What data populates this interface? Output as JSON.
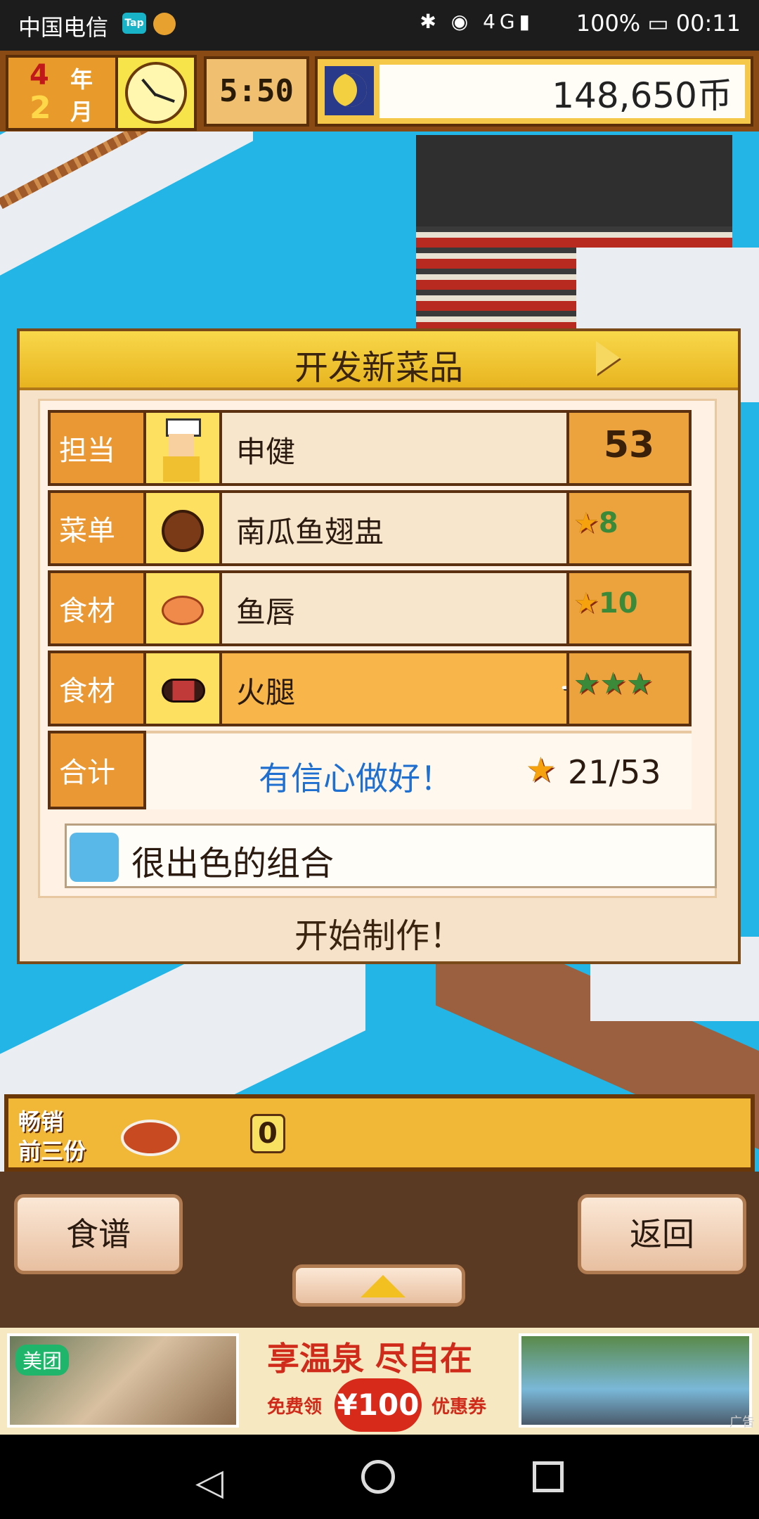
{
  "status_bar": {
    "carrier": "中国电信",
    "tap_badge": "Tap",
    "battery": "100%",
    "time": "00:11",
    "network": "4G"
  },
  "hud": {
    "year": "4",
    "year_label": "年",
    "month": "2",
    "month_label": "月",
    "game_time": "5:50",
    "money": "148,650币"
  },
  "dialog": {
    "title": "开发新菜品",
    "rows": [
      {
        "label": "担当",
        "name": "申健",
        "score": "53",
        "icon": "chef-icon"
      },
      {
        "label": "菜单",
        "name": "南瓜鱼翅盅",
        "stars": "8",
        "icon": "dish-icon"
      },
      {
        "label": "食材",
        "name": "鱼唇",
        "stars": "10",
        "icon": "fish-lip-icon"
      },
      {
        "label": "食材",
        "name": "火腿",
        "stars_count": 3,
        "icon": "ham-icon",
        "selected": true
      }
    ],
    "total": {
      "label": "合计",
      "confidence": "有信心做好！",
      "value": "21/53"
    },
    "comment": "很出色的组合",
    "start_button": "开始制作！"
  },
  "best_sellers": {
    "line1": "畅销",
    "line2": "前三份",
    "count": "0"
  },
  "buttons": {
    "recipe": "食谱",
    "back": "返回"
  },
  "ad": {
    "brand": "美团",
    "headline": "享温泉 尽自在",
    "free_label": "免费领",
    "amount": "¥100",
    "coupon_label": "优惠券",
    "ad_tag": "广告"
  },
  "colors": {
    "confidence_text": "#1f6fd0",
    "label_bg": "#e99833",
    "selected_row": "#f8b54a"
  }
}
